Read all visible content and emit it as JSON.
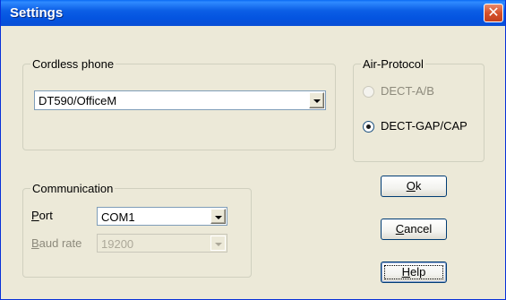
{
  "window": {
    "title": "Settings",
    "close_glyph": "✕"
  },
  "cordless_phone": {
    "legend": "Cordless phone",
    "selected": "DT590/OfficeM"
  },
  "air_protocol": {
    "legend": "Air-Protocol",
    "options": [
      {
        "label": "DECT-A/B",
        "checked": false,
        "enabled": false
      },
      {
        "label": "DECT-GAP/CAP",
        "checked": true,
        "enabled": true
      }
    ]
  },
  "communication": {
    "legend": "Communication",
    "port": {
      "label_mnemonic": "P",
      "label_rest": "ort",
      "value": "COM1",
      "enabled": true
    },
    "baud_rate": {
      "label_mnemonic": "B",
      "label_rest": "aud rate",
      "value": "19200",
      "enabled": false
    }
  },
  "buttons": {
    "ok": {
      "mnemonic": "O",
      "rest": "k"
    },
    "cancel": {
      "mnemonic": "C",
      "rest": "ancel"
    },
    "help": {
      "mnemonic": "H",
      "rest": "elp"
    }
  },
  "colors": {
    "titlebar": "#0454e0",
    "dialog_bg": "#ece9d8",
    "close_button": "#d6512b"
  },
  "icons": {
    "close": "close-icon",
    "dropdown": "chevron-down-icon"
  }
}
